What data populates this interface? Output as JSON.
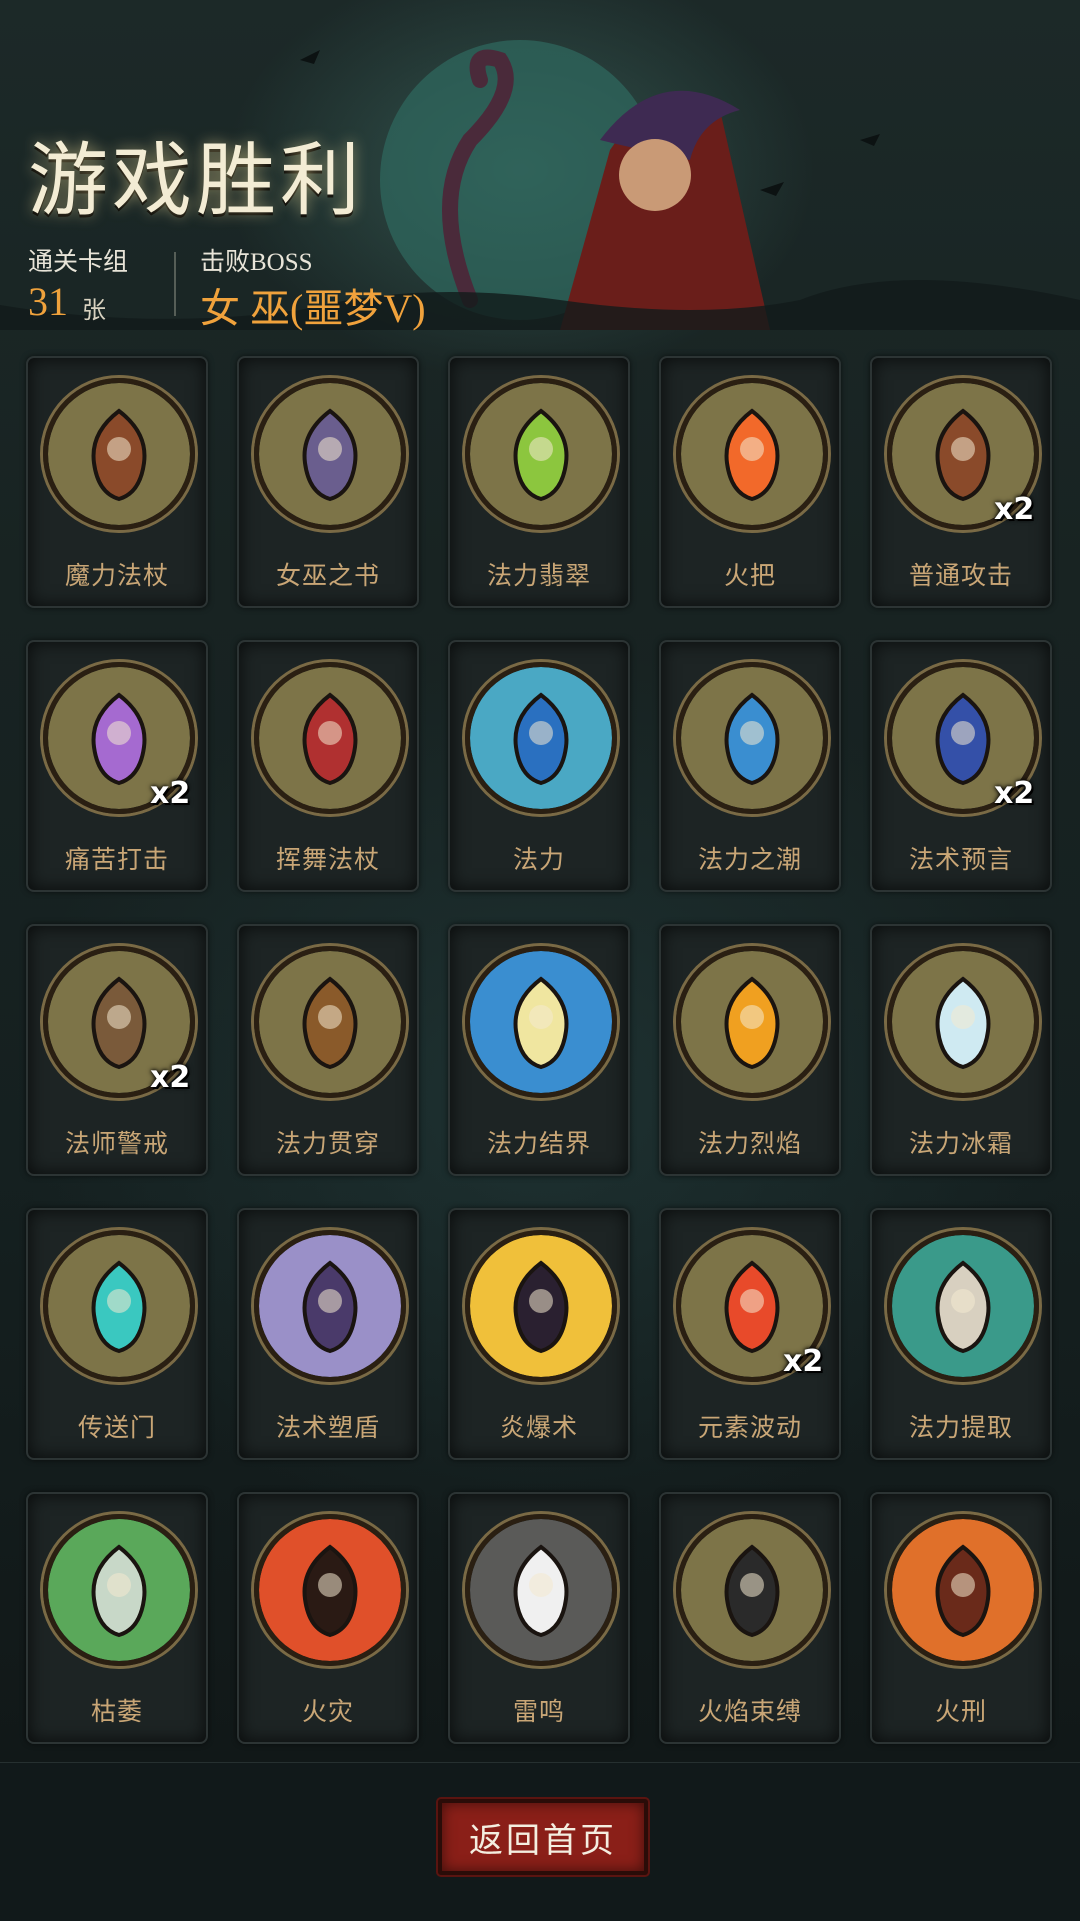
{
  "header": {
    "title": "游戏胜利",
    "deck_label": "通关卡组",
    "deck_count": "31",
    "deck_unit": "张",
    "boss_label": "击败BOSS",
    "boss_name": "女 巫(噩梦V)"
  },
  "cards": [
    {
      "name": "魔力法杖",
      "qty": "",
      "icon": "staff-icon",
      "bg": "#7d7448",
      "fg": "#8a4a2a"
    },
    {
      "name": "女巫之书",
      "qty": "",
      "icon": "book-icon",
      "bg": "#7d7448",
      "fg": "#6a5e8e"
    },
    {
      "name": "法力翡翠",
      "qty": "",
      "icon": "crystal-icon",
      "bg": "#7d7448",
      "fg": "#8cc63e"
    },
    {
      "name": "火把",
      "qty": "",
      "icon": "torch-icon",
      "bg": "#7d7448",
      "fg": "#f2692a"
    },
    {
      "name": "普通攻击",
      "qty": "x2",
      "icon": "staff-swing-icon",
      "bg": "#7d7448",
      "fg": "#8a4a2a"
    },
    {
      "name": "痛苦打击",
      "qty": "x2",
      "icon": "spirit-strike-icon",
      "bg": "#7d7448",
      "fg": "#a56ad0"
    },
    {
      "name": "挥舞法杖",
      "qty": "",
      "icon": "witch-wave-icon",
      "bg": "#7d7448",
      "fg": "#b03030"
    },
    {
      "name": "法力",
      "qty": "",
      "icon": "mana-orb-icon",
      "bg": "#4aa8c4",
      "fg": "#2a70c0"
    },
    {
      "name": "法力之潮",
      "qty": "",
      "icon": "wave-icon",
      "bg": "#7d7448",
      "fg": "#3a8ed0"
    },
    {
      "name": "法术预言",
      "qty": "x2",
      "icon": "crystal-ball-icon",
      "bg": "#7d7448",
      "fg": "#3450a8"
    },
    {
      "name": "法师警戒",
      "qty": "x2",
      "icon": "hooded-mage-icon",
      "bg": "#7d7448",
      "fg": "#7a5a3a"
    },
    {
      "name": "法力贯穿",
      "qty": "",
      "icon": "shield-pierce-icon",
      "bg": "#7d7448",
      "fg": "#8a5a2a"
    },
    {
      "name": "法力结界",
      "qty": "",
      "icon": "barrier-icon",
      "bg": "#3a8ed0",
      "fg": "#f0e6a0"
    },
    {
      "name": "法力烈焰",
      "qty": "",
      "icon": "zombie-flame-icon",
      "bg": "#7d7448",
      "fg": "#f0a020"
    },
    {
      "name": "法力冰霜",
      "qty": "",
      "icon": "frost-icon",
      "bg": "#7d7448",
      "fg": "#cfeaf2"
    },
    {
      "name": "传送门",
      "qty": "",
      "icon": "portal-icon",
      "bg": "#7d7448",
      "fg": "#3ac8c0"
    },
    {
      "name": "法术塑盾",
      "qty": "",
      "icon": "wizard-shield-icon",
      "bg": "#9a90c8",
      "fg": "#4a3a6a"
    },
    {
      "name": "炎爆术",
      "qty": "",
      "icon": "bat-moon-icon",
      "bg": "#f0c03a",
      "fg": "#2a2030"
    },
    {
      "name": "元素波动",
      "qty": "x2",
      "icon": "element-wave-icon",
      "bg": "#7d7448",
      "fg": "#e84a2a"
    },
    {
      "name": "法力提取",
      "qty": "",
      "icon": "skull-flame-icon",
      "bg": "#3a9a8a",
      "fg": "#d8d0c0"
    },
    {
      "name": "枯萎",
      "qty": "",
      "icon": "wither-ghost-icon",
      "bg": "#5aa85a",
      "fg": "#c8d8c8"
    },
    {
      "name": "火灾",
      "qty": "",
      "icon": "wildfire-icon",
      "bg": "#e0502a",
      "fg": "#2a1a14"
    },
    {
      "name": "雷鸣",
      "qty": "",
      "icon": "thunder-icon",
      "bg": "#5a5a58",
      "fg": "#f0f0f0"
    },
    {
      "name": "火焰束缚",
      "qty": "",
      "icon": "bound-skeleton-icon",
      "bg": "#7d7448",
      "fg": "#2a2a2a"
    },
    {
      "name": "火刑",
      "qty": "",
      "icon": "stake-fire-icon",
      "bg": "#e0702a",
      "fg": "#6a2a1a"
    }
  ],
  "footer": {
    "home_button_label": "返回首页"
  },
  "colors": {
    "accent_orange": "#f0a23c",
    "card_text": "#c9a676",
    "button_red": "#8a1f18"
  }
}
